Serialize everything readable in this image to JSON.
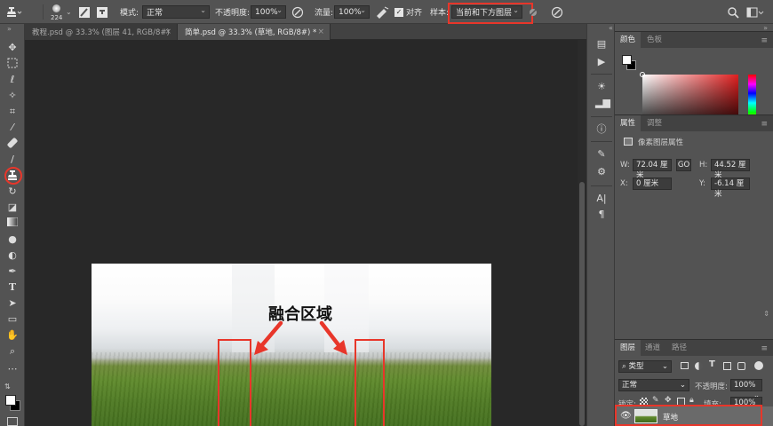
{
  "options_bar": {
    "brush_size": "224",
    "mode_label": "模式:",
    "mode_value": "正常",
    "opacity_label": "不透明度:",
    "opacity_value": "100%",
    "flow_label": "流量:",
    "flow_value": "100%",
    "align_label": "对齐",
    "sample_label": "样本:",
    "sample_value": "当前和下方图层"
  },
  "tabs": [
    {
      "label": "教程.psd @ 33.3% (图层 41, RGB/8#)",
      "active": false
    },
    {
      "label": "简单.psd @ 33.3% (草地, RGB/8#) *",
      "active": true
    }
  ],
  "canvas": {
    "annotation": "融合区域"
  },
  "color_panel": {
    "tab_color": "颜色",
    "tab_swatches": "色板"
  },
  "properties_panel": {
    "tab_properties": "属性",
    "tab_adjust": "调整",
    "heading": "像素图层属性",
    "w_label": "W:",
    "w_value": "72.04 厘米",
    "h_label": "H:",
    "h_value": "44.52 厘米",
    "x_label": "X:",
    "x_value": "0 厘米",
    "y_label": "Y:",
    "y_value": "-6.14 厘米",
    "link_label": "GO"
  },
  "layers_panel": {
    "tab_layers": "图层",
    "tab_channels": "通道",
    "tab_paths": "路径",
    "filter_kind": "类型",
    "blend_mode": "正常",
    "opacity_label": "不透明度:",
    "opacity_value": "100%",
    "lock_label": "锁定:",
    "fill_label": "填充:",
    "fill_value": "100%",
    "layer_name": "草地"
  },
  "colors": {
    "accent_red": "#e8362a"
  }
}
